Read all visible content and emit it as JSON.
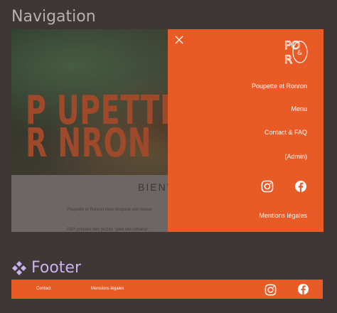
{
  "sections": {
    "navigation_title": "Navigation",
    "footer_title": "Footer"
  },
  "hero": {
    "logo_line1": "P   UPETTE",
    "logo_line2": "R   NRON",
    "logo_amp": "&",
    "welcome": "BIENV",
    "text1": "Poupette et Ronron vous propose une nouve",
    "text2": "P&R prépare des pizzas \"pala alla romana\""
  },
  "menu": {
    "close_icon": "close-icon",
    "logo": {
      "top": "PO",
      "bottom": "R",
      "amp": "&"
    },
    "items": [
      {
        "label": "Poupette et Ronron"
      },
      {
        "label": "Menu"
      },
      {
        "label": "Contact & FAQ"
      },
      {
        "label": "(Admin)"
      }
    ],
    "social": [
      "instagram-icon",
      "facebook-icon"
    ],
    "legal": "Mentions légales"
  },
  "footer": {
    "links": [
      {
        "label": "Contact"
      },
      {
        "label": "Mensions légales"
      }
    ],
    "social": [
      "instagram-icon",
      "facebook-icon"
    ]
  },
  "colors": {
    "background": "#3f3636",
    "accent": "#e85a26",
    "footer_heading": "#c9b3ef",
    "navigation_heading": "#b8b0ad"
  }
}
